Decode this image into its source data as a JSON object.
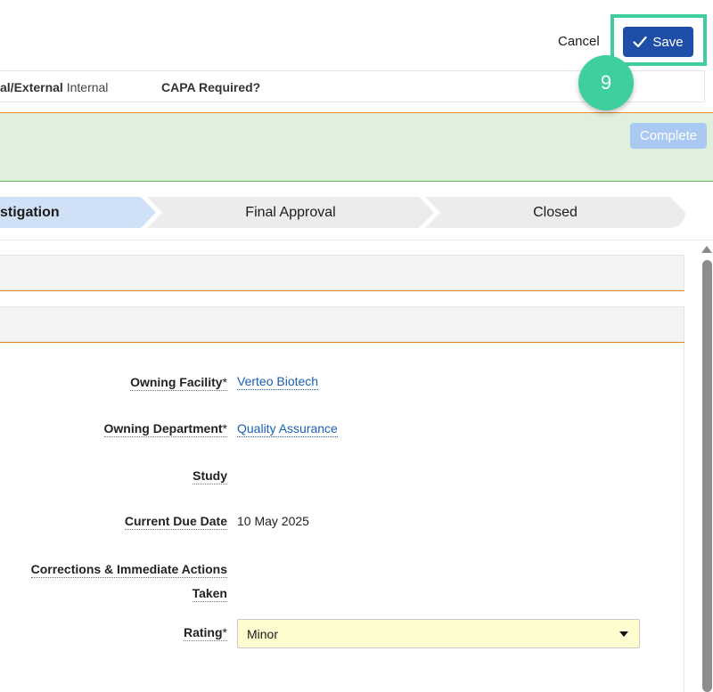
{
  "toolbar": {
    "cancel_label": "Cancel",
    "save_label": "Save"
  },
  "step_badge": "9",
  "info_strip": {
    "internal_external_label": "al/External",
    "internal_external_value": "Internal",
    "capa_required_label": "CAPA Required?"
  },
  "actions": {
    "complete_label": "Complete"
  },
  "stages": [
    {
      "label": "stigation",
      "state": "active"
    },
    {
      "label": "Final Approval",
      "state": "pending"
    },
    {
      "label": "Closed",
      "state": "pending"
    }
  ],
  "form": {
    "owning_facility": {
      "label": "Owning Facility",
      "required": "*",
      "value": "Verteo Biotech"
    },
    "owning_department": {
      "label": "Owning Department",
      "required": "*",
      "value": "Quality Assurance"
    },
    "study": {
      "label": "Study",
      "value": ""
    },
    "current_due_date": {
      "label": "Current Due Date",
      "value": "10 May 2025"
    },
    "corrections": {
      "label_line1": "Corrections & Immediate Actions",
      "label_line2": "Taken",
      "value": ""
    },
    "rating": {
      "label": "Rating",
      "required": "*",
      "value": "Minor"
    }
  },
  "colors": {
    "primary": "#1f4ea8",
    "highlight": "#3ecf9d",
    "complete_disabled": "#a9c8f2",
    "active_stage": "#cfe0f7",
    "green_panel": "#dff0dc",
    "orange_rule": "#e08a2a",
    "link": "#1a5fb4",
    "select_bg": "#fdfdd0"
  }
}
